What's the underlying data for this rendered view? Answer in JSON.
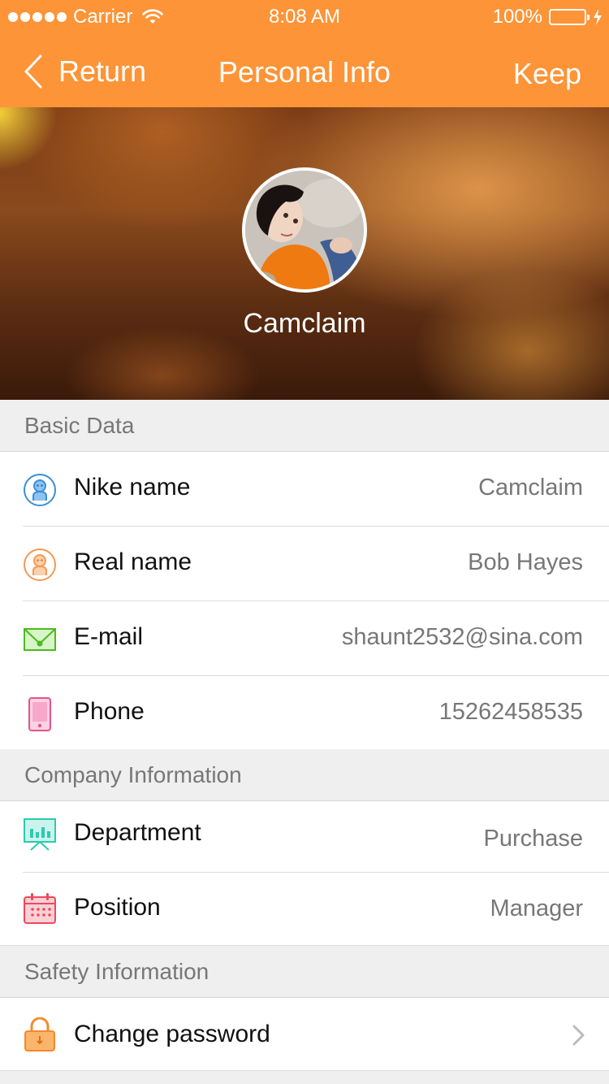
{
  "status_bar": {
    "carrier": "Carrier",
    "time": "8:08 AM",
    "battery": "100%"
  },
  "nav": {
    "back_label": "Return",
    "title": "Personal Info",
    "action_label": "Keep"
  },
  "profile": {
    "name": "Camclaim"
  },
  "sections": {
    "basic": {
      "title": "Basic Data",
      "rows": [
        {
          "label": "Nike name",
          "value": "Camclaim",
          "icon": "person-icon-blue"
        },
        {
          "label": "Real name",
          "value": "Bob Hayes",
          "icon": "person-icon-orange"
        },
        {
          "label": "E-mail",
          "value": "shaunt2532@sina.com",
          "icon": "mail-icon"
        },
        {
          "label": "Phone",
          "value": "15262458535",
          "icon": "phone-icon"
        }
      ]
    },
    "company": {
      "title": "Company Information",
      "rows": [
        {
          "label": "Department",
          "value": "Purchase",
          "icon": "presentation-board-icon"
        },
        {
          "label": "Position",
          "value": "Manager",
          "icon": "calendar-icon"
        }
      ]
    },
    "safety": {
      "title": "Safety Information",
      "rows": [
        {
          "label": "Change password",
          "icon": "lock-icon"
        }
      ]
    }
  },
  "colors": {
    "accent": "#fd9437",
    "section_bg": "#efefef",
    "value_text": "#777777"
  }
}
